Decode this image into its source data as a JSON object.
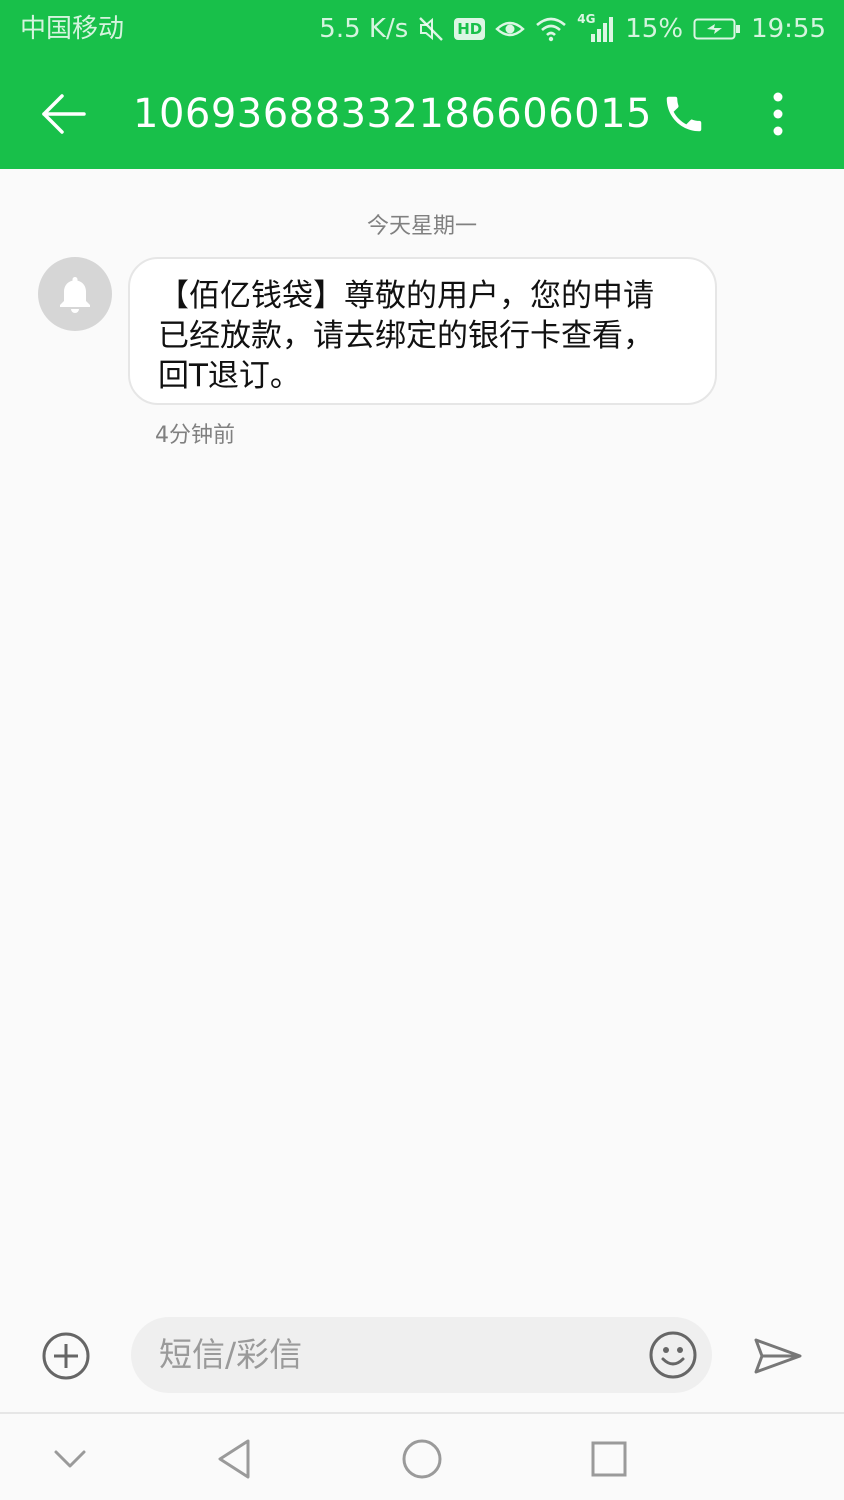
{
  "colors": {
    "accent": "#18c04a"
  },
  "status_bar": {
    "carrier": "中国移动",
    "net_speed": "5.5 K/s",
    "hd_badge": "HD",
    "network_type": "4G",
    "battery_percent": "15%",
    "time": "19:55",
    "icons": [
      "mute-icon",
      "hd-icon",
      "eye-icon",
      "wifi-icon",
      "signal-icon",
      "battery-charging-icon"
    ]
  },
  "header": {
    "title": "10693688332186606015",
    "icons": [
      "back-arrow-icon",
      "phone-icon",
      "more-vert-icon"
    ]
  },
  "conversation": {
    "date_separator": "今天星期一",
    "messages": [
      {
        "avatar_icon": "bell-icon",
        "line1": "【佰亿钱袋】尊敬的用户，您的申请",
        "line2": "已经放款，请去绑定的银行卡查看，",
        "line3": "回T退订。",
        "time": "4分钟前"
      }
    ]
  },
  "composer": {
    "placeholder": "短信/彩信",
    "icons": [
      "add-circle-icon",
      "emoji-icon",
      "send-icon"
    ]
  },
  "nav_bar": {
    "icons": [
      "chevron-down-icon",
      "nav-back-icon",
      "nav-home-icon",
      "nav-recents-icon"
    ]
  }
}
